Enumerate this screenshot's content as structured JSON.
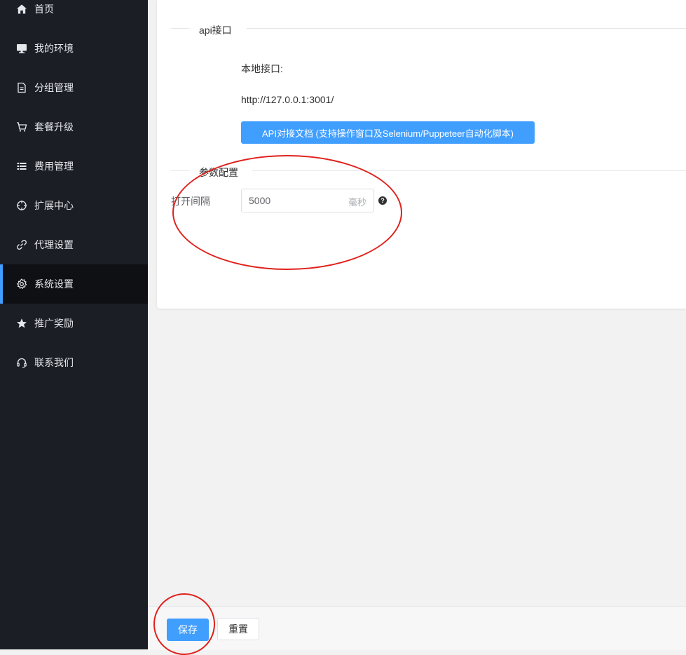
{
  "sidebar": {
    "items": [
      {
        "label": "首页",
        "icon": "home-icon"
      },
      {
        "label": "我的环境",
        "icon": "monitor-icon"
      },
      {
        "label": "分组管理",
        "icon": "document-icon"
      },
      {
        "label": "套餐升级",
        "icon": "cart-icon"
      },
      {
        "label": "费用管理",
        "icon": "list-icon"
      },
      {
        "label": "扩展中心",
        "icon": "crosshair-icon"
      },
      {
        "label": "代理设置",
        "icon": "link-icon"
      },
      {
        "label": "系统设置",
        "icon": "gear-icon",
        "active": true
      },
      {
        "label": "推广奖励",
        "icon": "star-icon"
      },
      {
        "label": "联系我们",
        "icon": "headset-icon"
      }
    ]
  },
  "api_section": {
    "title": "api接口",
    "local_label": "本地接口:",
    "local_url": "http://127.0.0.1:3001/",
    "doc_button": "API对接文档 (支持操作窗口及Selenium/Puppeteer自动化脚本)"
  },
  "params_section": {
    "title": "参数配置",
    "interval_label": "打开间隔",
    "interval_value": "5000",
    "interval_unit": "毫秒",
    "help_glyph": "?"
  },
  "footer": {
    "save_label": "保存",
    "reset_label": "重置"
  },
  "colors": {
    "sidebar_bg": "#1c1e26",
    "accent": "#409eff",
    "annotation": "#e0201b"
  }
}
